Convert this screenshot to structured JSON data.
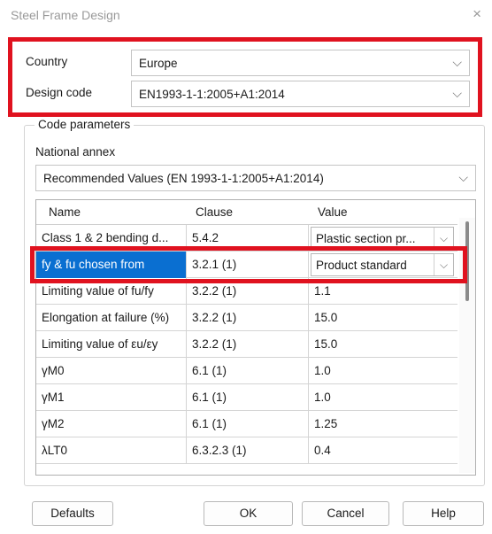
{
  "window": {
    "title": "Steel Frame Design",
    "close_glyph": "×"
  },
  "country": {
    "label": "Country",
    "value": "Europe"
  },
  "design_code": {
    "label": "Design code",
    "value": "EN1993-1-1:2005+A1:2014"
  },
  "code_parameters": {
    "title": "Code parameters",
    "national_annex": {
      "label": "National annex",
      "value": "Recommended Values (EN 1993-1-1:2005+A1:2014)"
    },
    "table": {
      "headers": [
        "Name",
        "Clause",
        "Value"
      ],
      "rows": [
        {
          "name": "Class 1 & 2 bending d...",
          "clause": "5.4.2",
          "value": "Plastic section pr..."
        },
        {
          "name": "fy & fu chosen from",
          "clause": "3.2.1 (1)",
          "value": "Product standard"
        },
        {
          "name": "Limiting value of fu/fy",
          "clause": "3.2.2 (1)",
          "value": "1.1"
        },
        {
          "name": "Elongation at failure (%)",
          "clause": "3.2.2 (1)",
          "value": "15.0"
        },
        {
          "name": "Limiting value of εu/εy",
          "clause": "3.2.2 (1)",
          "value": "15.0"
        },
        {
          "name": "γM0",
          "clause": "6.1 (1)",
          "value": "1.0"
        },
        {
          "name": "γM1",
          "clause": "6.1 (1)",
          "value": "1.0"
        },
        {
          "name": "γM2",
          "clause": "6.1 (1)",
          "value": "1.25"
        },
        {
          "name": "λLT0",
          "clause": "6.3.2.3 (1)",
          "value": "0.4"
        }
      ]
    }
  },
  "buttons": {
    "defaults": "Defaults",
    "ok": "OK",
    "cancel": "Cancel",
    "help": "Help"
  },
  "icons": {
    "dropdown": "chevron-down-icon",
    "close": "close-icon"
  },
  "colors": {
    "highlight_border": "#e0121f",
    "selection": "#0a6fd1"
  }
}
